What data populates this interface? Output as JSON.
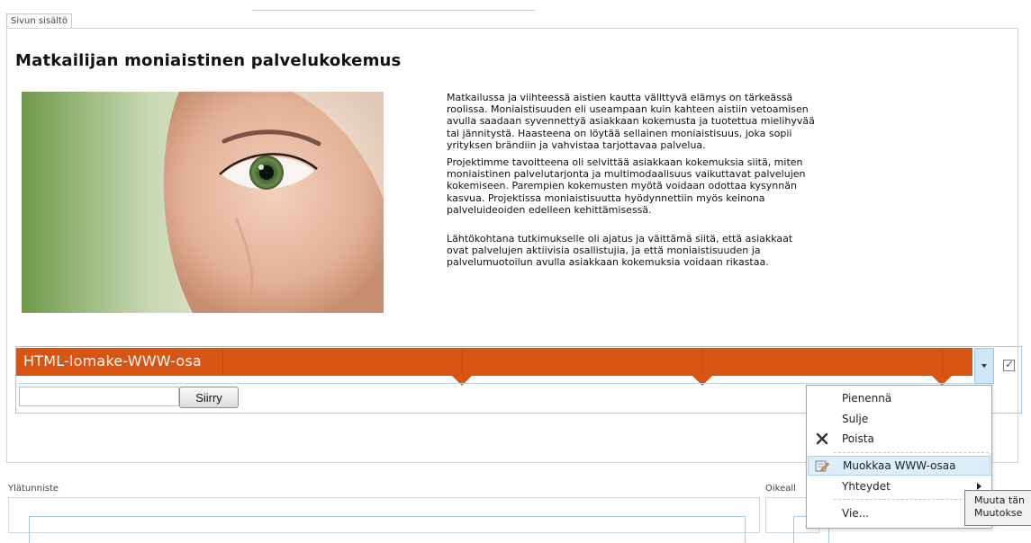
{
  "zones": {
    "content_tab": "Sivun sisältö",
    "header_zone": "Ylätunniste",
    "right_zone": "Oikeall"
  },
  "article": {
    "title": "Matkailijan moniaistinen palvelukokemus",
    "paragraphs": [
      "Matkailussa ja viihteessä aistien kautta välittyvä elämys on tärkeässä roolissa. Moniaistisuuden eli useampaan kuin kahteen aistiin vetoamisen avulla saadaan syvennettyä asiakkaan kokemusta ja tuotettua mielihyvää tai jännitystä. Haasteena on löytää sellainen moniaistisuus, joka sopii yrityksen brändiin ja vahvistaa tarjottavaa palvelua.",
      "Projektimme tavoitteena oli selvittää asiakkaan kokemuksia siitä, miten moniaistinen palvelutarjonta ja multimodaalisuus vaikuttavat palvelujen kokemiseen. Parempien kokemusten myötä voidaan odottaa kysynnän kasvua. Projektissa moniaistisuutta hyödynnettiin myös keinona palveluideoiden edelleen kehittämisessä.",
      "Lähtökohtana tutkimukselle oli ajatus ja väittämä siitä, että asiakkaat ovat palvelujen aktiivisia osallistujia, ja että moniaistisuuden ja palvelumuotoilun avulla asiakkaan kokemuksia voidaan rikastaa."
    ]
  },
  "webpart": {
    "title": "HTML-lomake-WWW-osa",
    "input_value": "",
    "go_button": "Siirry",
    "checkbox_checked": true
  },
  "context_menu": {
    "items": [
      "Pienennä",
      "Sulje",
      "Poista",
      "Muokkaa WWW-osaa",
      "Yhteydet",
      "Vie..."
    ]
  },
  "tooltip": {
    "line1": "Muuta tän",
    "line2": "Muutokse"
  },
  "colors": {
    "accent": "#d75413",
    "menu_highlight": "#dceefa",
    "frame_border": "#a6cbe0"
  }
}
